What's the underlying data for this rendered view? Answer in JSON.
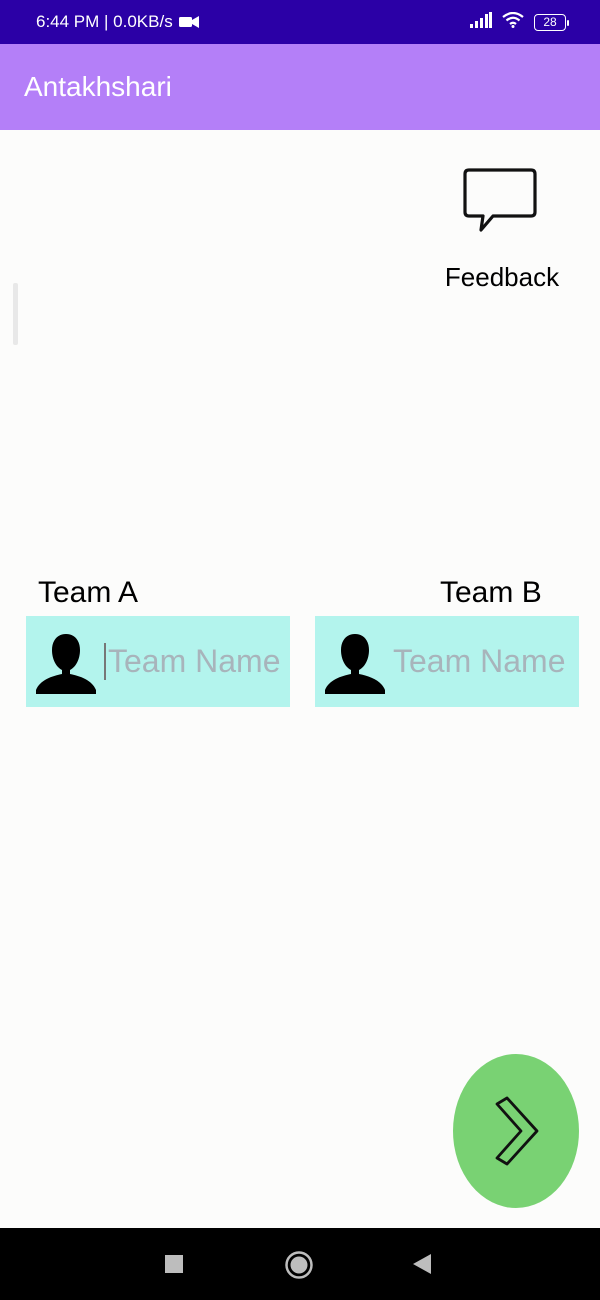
{
  "status_bar": {
    "time_speed": "6:44 PM | 0.0KB/s",
    "battery": "28",
    "icons": [
      "video-camera-icon",
      "signal-icon",
      "wifi-icon",
      "battery-icon"
    ]
  },
  "app_bar": {
    "title": "Antakhshari"
  },
  "feedback": {
    "label": "Feedback",
    "icon": "speech-bubble-icon"
  },
  "teams": {
    "team_a": {
      "label": "Team A",
      "placeholder": "Team Name",
      "value": ""
    },
    "team_b": {
      "label": "Team B",
      "placeholder": "Team Name",
      "value": ""
    }
  },
  "next_button": {
    "icon": "chevron-right-icon",
    "color": "#79d273"
  },
  "nav_bar": {
    "icons": [
      "recents-square-icon",
      "home-circle-icon",
      "back-triangle-icon"
    ]
  },
  "colors": {
    "status_bar": "#2b00a6",
    "app_bar": "#b47ff8",
    "team_field": "#b3f4ed",
    "fab": "#79d273"
  }
}
